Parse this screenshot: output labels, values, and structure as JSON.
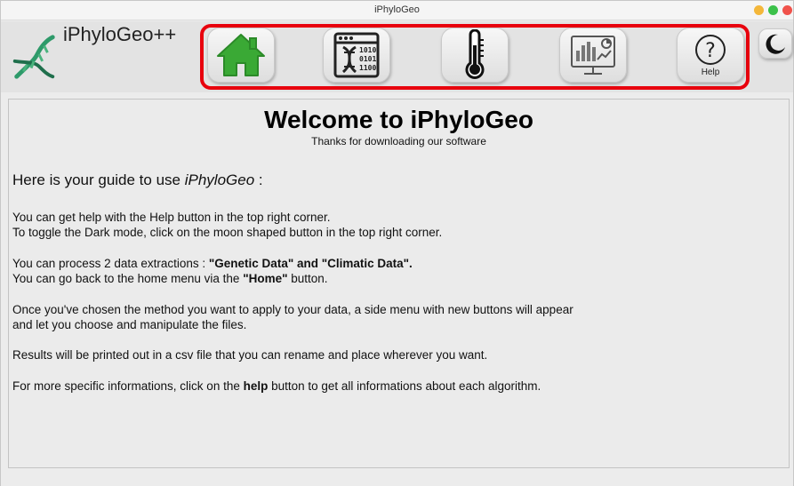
{
  "window": {
    "title": "iPhyloGeo"
  },
  "header": {
    "brand": "iPhyloGeo++",
    "nav": [
      {
        "icon": "home-icon",
        "label": ""
      },
      {
        "icon": "genetic-data-icon",
        "label": ""
      },
      {
        "icon": "thermometer-icon",
        "label": ""
      },
      {
        "icon": "results-chart-icon",
        "label": ""
      },
      {
        "icon": "help-icon",
        "label": "Help"
      }
    ],
    "dark_mode_icon": "moon-icon"
  },
  "main": {
    "title": "Welcome to iPhyloGeo",
    "subtitle": "Thanks for downloading our software",
    "guide_prefix": "Here is your guide to use ",
    "guide_app": "iPhyloGeo",
    "guide_suffix": " :",
    "p1": {
      "line1": "You can get help with the Help button in the top right corner.",
      "line2": "To toggle the Dark mode, click on the moon shaped button in the top right corner."
    },
    "p2": {
      "line1_prefix": "You can process 2 data extractions : ",
      "line1_bold": "\"Genetic Data\" and \"Climatic Data\".",
      "line2_prefix": "You can go back to the home menu via the ",
      "line2_bold": "\"Home\"",
      "line2_suffix": " button."
    },
    "p3": {
      "line1": "Once you've chosen the method you want to apply to your data, a side menu with new buttons will appear",
      "line2": "and let you choose and manipulate the files."
    },
    "p4": "Results will be printed out in a csv file that you can rename and place wherever you want.",
    "p5": {
      "prefix": "For more specific informations, click on the ",
      "bold": "help",
      "suffix": " button to get all informations about each algorithm."
    }
  },
  "colors": {
    "highlight": "#e8000d",
    "home_green": "#3aa935",
    "logo_green": "#2e9a6a"
  }
}
